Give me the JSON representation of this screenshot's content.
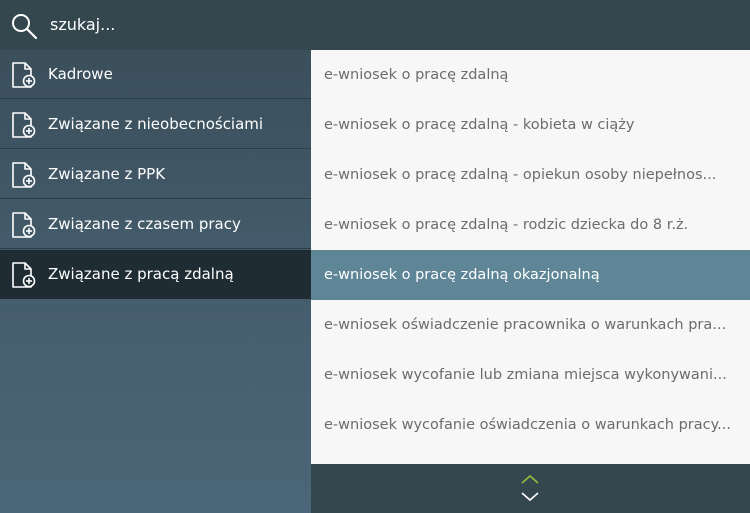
{
  "search": {
    "placeholder": "szukaj..."
  },
  "sidebar": {
    "items": [
      {
        "label": "Kadrowe"
      },
      {
        "label": "Związane z nieobecnościami"
      },
      {
        "label": "Związane z PPK"
      },
      {
        "label": "Związane z czasem pracy"
      },
      {
        "label": "Związane z pracą zdalną"
      }
    ],
    "active_index": 4
  },
  "list": {
    "items": [
      {
        "label": "e-wniosek o pracę zdalną"
      },
      {
        "label": "e-wniosek o pracę zdalną - kobieta w ciąży"
      },
      {
        "label": "e-wniosek o pracę zdalną - opiekun osoby niepełnos..."
      },
      {
        "label": "e-wniosek o pracę zdalną - rodzic dziecka do 8 r.ż."
      },
      {
        "label": "e-wniosek o pracę zdalną okazjonalną"
      },
      {
        "label": "e-wniosek oświadczenie pracownika o warunkach pra..."
      },
      {
        "label": "e-wniosek wycofanie lub zmiana miejsca wykonywani..."
      },
      {
        "label": "e-wniosek wycofanie oświadczenia o warunkach pracy..."
      }
    ],
    "active_index": 4
  },
  "icons": {
    "search": "search-icon",
    "document": "document-add-icon",
    "scroll_up": "chevron-up-icon",
    "scroll_down": "chevron-down-icon"
  },
  "colors": {
    "accent": "#5e8696",
    "scroll_up": "#8fbf3a",
    "scroll_down": "#ffffff"
  }
}
